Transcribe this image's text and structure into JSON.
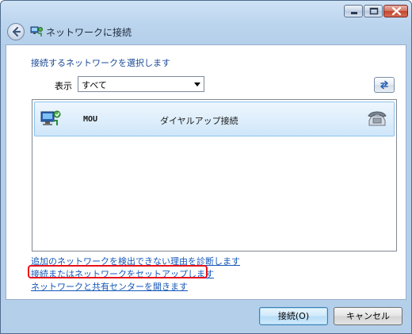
{
  "window": {
    "title": "ネットワークに接続",
    "colors": {
      "frame": "#b4cfea",
      "accent": "#1a4a96",
      "link": "#1558b8",
      "highlight": "#e8101a"
    }
  },
  "titlebar": {
    "minimize_icon": "minimize-icon",
    "maximize_icon": "maximize-icon",
    "close_icon": "close-icon"
  },
  "main": {
    "instruction": "接続するネットワークを選択します",
    "show_label": "表示",
    "filter_selected": "すべて",
    "networks": [
      {
        "name": "MOU",
        "type": "ダイヤルアップ接続",
        "icon": "network-connection-icon",
        "type_icon": "telephone-icon",
        "selected": true
      }
    ],
    "links": {
      "diagnose": "追加のネットワークを検出できない理由を診断します",
      "setup": "接続またはネットワークをセットアップします",
      "sharing_center": "ネットワークと共有センターを開きます"
    }
  },
  "footer": {
    "connect_label": "接続(O)",
    "cancel_label": "キャンセル"
  }
}
